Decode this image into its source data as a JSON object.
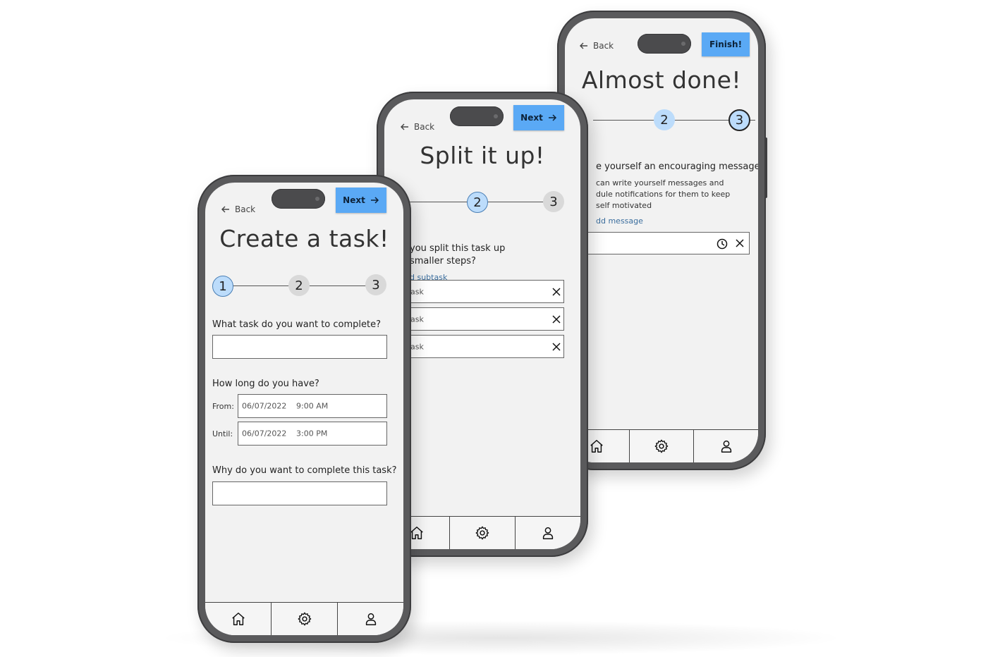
{
  "common": {
    "back_label": "Back",
    "next_label": "Next",
    "finish_label": "Finish!",
    "step_1": "1",
    "step_2": "2",
    "step_3": "3"
  },
  "phone1": {
    "title": "Create a task!",
    "q_task": "What task do you want to complete?",
    "q_time": "How long do you have?",
    "from_label": "From:",
    "from_date": "06/07/2022",
    "from_time": "9:00 AM",
    "until_label": "Until:",
    "until_date": "06/07/2022",
    "until_time": "3:00 PM",
    "q_why": "Why do you want to complete this task?"
  },
  "phone2": {
    "title": "Split it up!",
    "question_line1": "you split this task up",
    "question_line2": "smaller steps?",
    "add_link": "d subtask",
    "subtasks": [
      "ask",
      "ask",
      "ask"
    ]
  },
  "phone3": {
    "title": "Almost done!",
    "heading": "e yourself an encouraging message",
    "desc_line1": "can write yourself messages and",
    "desc_line2": "dule notifications for them to keep",
    "desc_line3": "self motivated",
    "add_link": "dd message"
  },
  "colors": {
    "accent": "#5aa9f5",
    "step_active": "#bcdcfb",
    "step_idle": "#d9d9d9",
    "screen_bg": "#f2f2f2",
    "frame": "#5a5a5c",
    "link": "#3b6e9e"
  },
  "icons": [
    "arrow-left-icon",
    "arrow-right-icon",
    "close-icon",
    "clock-icon",
    "home-icon",
    "gear-icon",
    "user-icon"
  ]
}
